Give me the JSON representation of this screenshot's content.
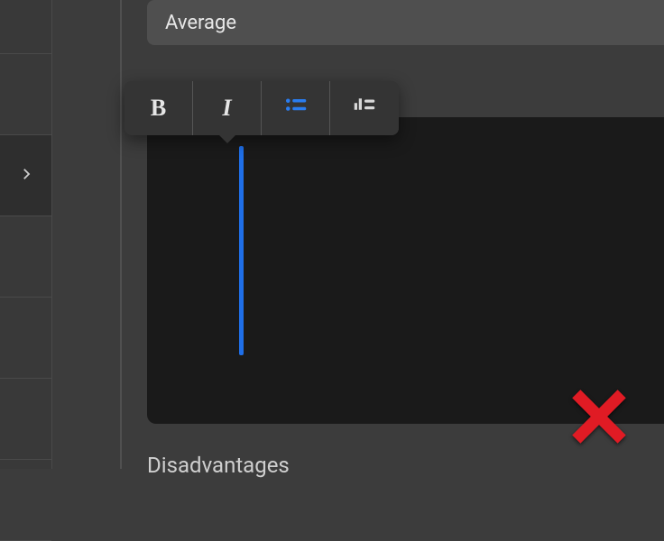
{
  "field_value": "Average",
  "section_below": "Disadvantages",
  "toolbar": {
    "bold": {
      "name": "bold-button",
      "glyph": "B"
    },
    "italic": {
      "name": "italic-button",
      "glyph": "I"
    },
    "bullets": {
      "name": "bullet-list-button"
    },
    "checklist": {
      "name": "checklist-button"
    }
  },
  "colors": {
    "accent": "#1f6fe8",
    "close": "#e01b24"
  }
}
